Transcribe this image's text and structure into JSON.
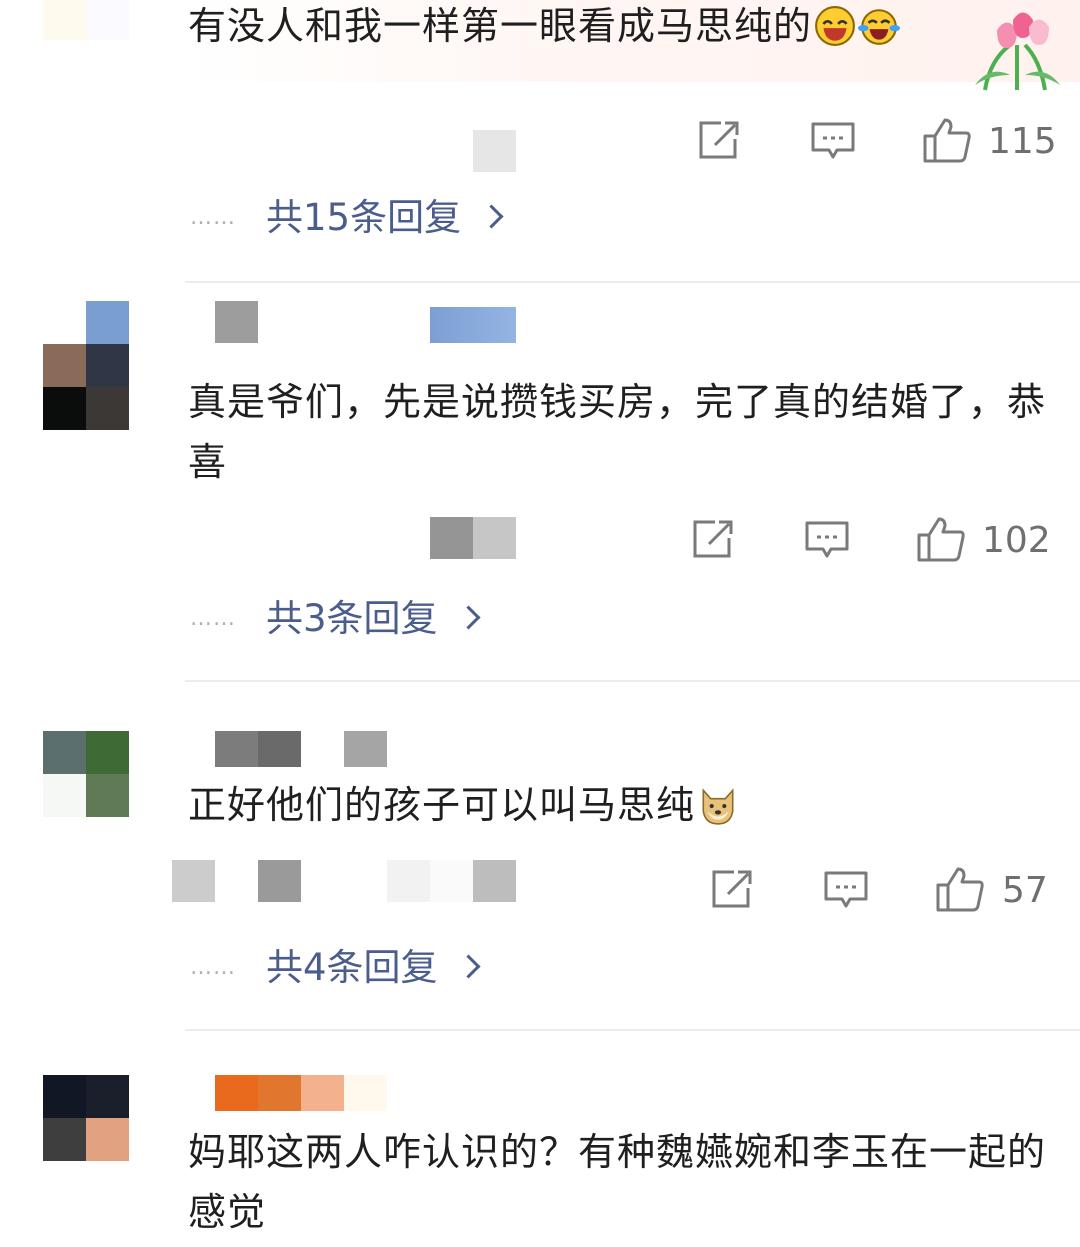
{
  "comments": [
    {
      "text": "有没人和我一样第一眼看成马思纯的",
      "emojis": [
        "laughing-face-icon",
        "crying-laughing-face-icon"
      ],
      "likes": "115",
      "replies_label": "共15条回复",
      "dots": "……"
    },
    {
      "text": "真是爷们，先是说攒钱买房，完了真的结婚了，恭喜",
      "likes": "102",
      "replies_label": "共3条回复",
      "dots": "……"
    },
    {
      "text": "正好他们的孩子可以叫马思纯",
      "emojis": [
        "doge-icon"
      ],
      "likes": "57",
      "replies_label": "共4条回复",
      "dots": "……"
    },
    {
      "text": "妈耶这两人咋认识的？有种魏嬿婉和李玉在一起的感觉"
    }
  ],
  "icons": {
    "share": "share-icon",
    "comment": "comment-icon",
    "like": "thumbs-up-icon",
    "badge": "tulip-badge-icon",
    "chevron": "chevron-right-icon"
  },
  "colors": {
    "reply_link": "#4b5d8c",
    "count": "#6f6f6f",
    "icon": "#777777"
  }
}
